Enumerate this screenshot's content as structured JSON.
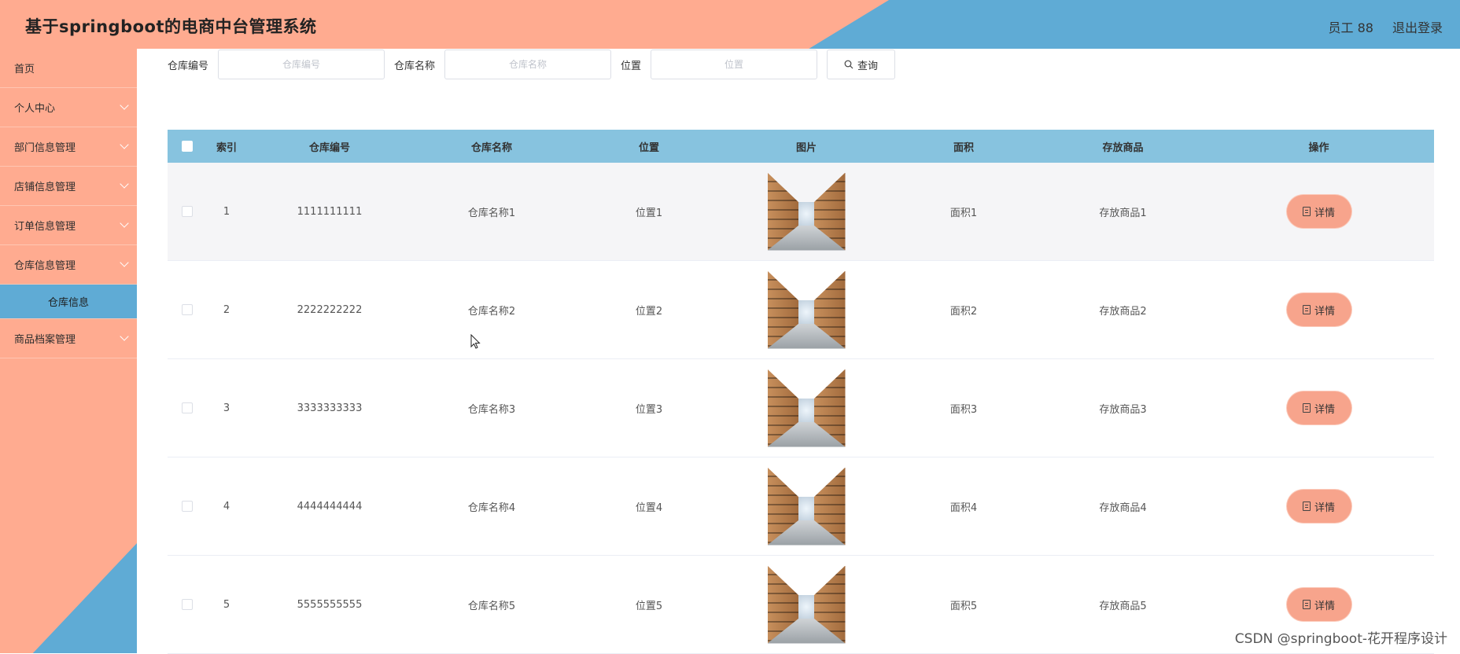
{
  "header": {
    "title": "基于springboot的电商中台管理系统",
    "user_label": "员工 88",
    "logout_label": "退出登录",
    "colors": {
      "salmon": "#ffab90",
      "blue": "#5fabd5"
    }
  },
  "sidebar": {
    "items": [
      {
        "label": "首页",
        "expandable": false
      },
      {
        "label": "个人中心",
        "expandable": true
      },
      {
        "label": "部门信息管理",
        "expandable": true
      },
      {
        "label": "店铺信息管理",
        "expandable": true
      },
      {
        "label": "订单信息管理",
        "expandable": true
      },
      {
        "label": "仓库信息管理",
        "expandable": true,
        "expanded": true
      }
    ],
    "active_submenu": "仓库信息",
    "after_items": [
      {
        "label": "商品档案管理",
        "expandable": true
      }
    ]
  },
  "search": {
    "code_label": "仓库编号",
    "code_placeholder": "仓库编号",
    "name_label": "仓库名称",
    "name_placeholder": "仓库名称",
    "loc_label": "位置",
    "loc_placeholder": "位置",
    "query_label": "查询"
  },
  "table": {
    "headers": {
      "index": "索引",
      "code": "仓库编号",
      "name": "仓库名称",
      "location": "位置",
      "image": "图片",
      "area": "面积",
      "goods": "存放商品",
      "op": "操作"
    },
    "detail_label": "详情",
    "rows": [
      {
        "index": "1",
        "code": "1111111111",
        "name": "仓库名称1",
        "location": "位置1",
        "area": "面积1",
        "goods": "存放商品1"
      },
      {
        "index": "2",
        "code": "2222222222",
        "name": "仓库名称2",
        "location": "位置2",
        "area": "面积2",
        "goods": "存放商品2"
      },
      {
        "index": "3",
        "code": "3333333333",
        "name": "仓库名称3",
        "location": "位置3",
        "area": "面积3",
        "goods": "存放商品3"
      },
      {
        "index": "4",
        "code": "4444444444",
        "name": "仓库名称4",
        "location": "位置4",
        "area": "面积4",
        "goods": "存放商品4"
      },
      {
        "index": "5",
        "code": "5555555555",
        "name": "仓库名称5",
        "location": "位置5",
        "area": "面积5",
        "goods": "存放商品5"
      }
    ]
  },
  "watermark": "CSDN @springboot-花开程序设计"
}
